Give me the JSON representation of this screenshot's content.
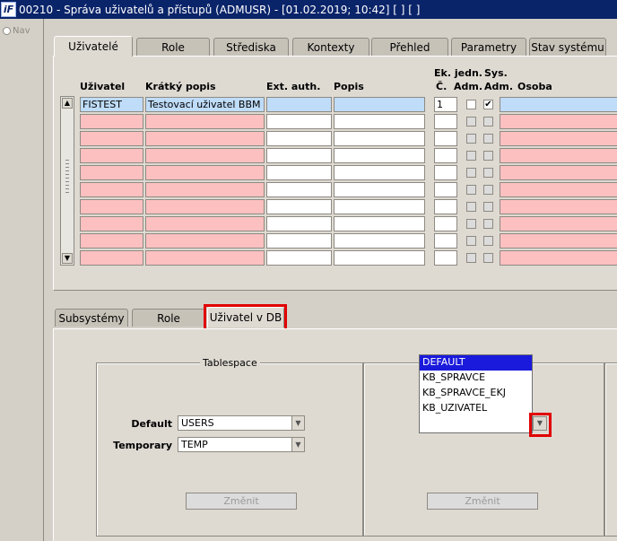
{
  "window": {
    "title": "00210 - Správa uživatelů a přístupů (ADMUSR) - [01.02.2019; 10:42] [ ] [ ]",
    "icon": "app-icon"
  },
  "nav": {
    "label": "Nav"
  },
  "top_tabs": [
    "Uživatelé",
    "Role",
    "Střediska",
    "Kontexty",
    "Přehled",
    "Parametry",
    "Stav systému"
  ],
  "table": {
    "headers": {
      "uzivatel": "Uživatel",
      "kratky_popis": "Krátký popis",
      "ext_auth": "Ext. auth.",
      "popis": "Popis",
      "ek_jedn_line1": "Ek. jedn.",
      "ek_jedn_line2": "Č.",
      "adm_line": "Adm.",
      "sys_line1": "Sys.",
      "sys_line2": "Adm.",
      "osoba": "Osoba"
    },
    "first_row": {
      "uzivatel": "FISTEST",
      "kratky_popis": "Testovací uživatel BBM",
      "ek_jedn": "1",
      "sys_adm_checked": "✔"
    }
  },
  "bottom_tabs": [
    "Subsystémy",
    "Role",
    "Uživatel v DB"
  ],
  "tablespace": {
    "legend": "Tablespace",
    "default_label": "Default",
    "default_value": "USERS",
    "temporary_label": "Temporary",
    "temporary_value": "TEMP",
    "change_button": "Změnit"
  },
  "profile": {
    "options": [
      "DEFAULT",
      "KB_SPRAVCE",
      "KB_SPRAVCE_EKJ",
      "KB_UZIVATEL"
    ],
    "selected": "DEFAULT",
    "change_button": "Změnit"
  },
  "highlight_color": "#e00000"
}
